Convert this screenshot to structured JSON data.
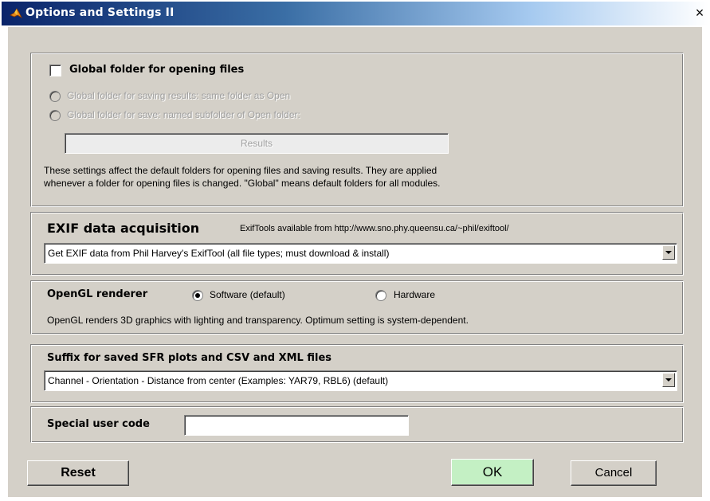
{
  "window": {
    "title": "Options and Settings II",
    "close_label": "×",
    "accent": "#0a246a",
    "face_color": "#d4d0c8"
  },
  "global_folder": {
    "checkbox_label": "Global folder for opening files",
    "checked": false,
    "radio_same_folder": "Global folder for saving results: same folder as Open",
    "radio_subfolder": "Global folder for save: named subfolder of Open folder:",
    "subfolder_value": "Results",
    "description_line1": "These settings affect the default folders for opening files and saving results. They are applied",
    "description_line2": "whenever a folder for opening files is changed. \"Global\" means default folders for all modules."
  },
  "exif": {
    "heading": "EXIF data acquisition",
    "note": "ExifTools available from http://www.sno.phy.queensu.ca/~phil/exiftool/",
    "selected": "Get EXIF data from Phil Harvey's ExifTool (all file types; must download & install)"
  },
  "opengl": {
    "heading": "OpenGL renderer",
    "option_software": "Software (default)",
    "option_hardware": "Hardware",
    "selected": "Software (default)",
    "description": "OpenGL renders 3D graphics with lighting and transparency. Optimum setting is system-dependent."
  },
  "suffix": {
    "heading": "Suffix for saved SFR plots and CSV and XML files",
    "selected": "Channel - Orientation - Distance from center  (Examples:  YAR79,  RBL6)  (default)"
  },
  "special": {
    "label": "Special user code",
    "value": ""
  },
  "buttons": {
    "reset": "Reset",
    "ok": "OK",
    "ok_color": "#c4f0c4",
    "cancel": "Cancel"
  },
  "icons": {
    "title_icon": "matlab-logo-icon",
    "dropdown_arrow": "chevron-down-icon"
  }
}
